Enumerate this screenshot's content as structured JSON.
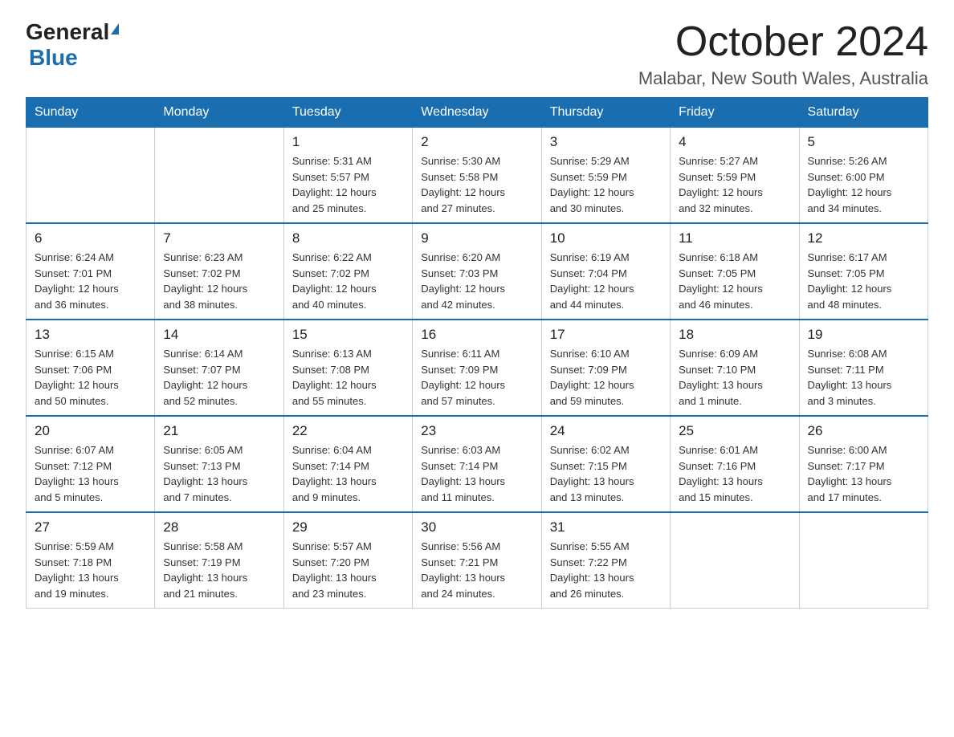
{
  "header": {
    "logo_general": "General",
    "logo_blue": "Blue",
    "title": "October 2024",
    "subtitle": "Malabar, New South Wales, Australia"
  },
  "weekdays": [
    "Sunday",
    "Monday",
    "Tuesday",
    "Wednesday",
    "Thursday",
    "Friday",
    "Saturday"
  ],
  "weeks": [
    [
      {
        "day": "",
        "info": ""
      },
      {
        "day": "",
        "info": ""
      },
      {
        "day": "1",
        "info": "Sunrise: 5:31 AM\nSunset: 5:57 PM\nDaylight: 12 hours\nand 25 minutes."
      },
      {
        "day": "2",
        "info": "Sunrise: 5:30 AM\nSunset: 5:58 PM\nDaylight: 12 hours\nand 27 minutes."
      },
      {
        "day": "3",
        "info": "Sunrise: 5:29 AM\nSunset: 5:59 PM\nDaylight: 12 hours\nand 30 minutes."
      },
      {
        "day": "4",
        "info": "Sunrise: 5:27 AM\nSunset: 5:59 PM\nDaylight: 12 hours\nand 32 minutes."
      },
      {
        "day": "5",
        "info": "Sunrise: 5:26 AM\nSunset: 6:00 PM\nDaylight: 12 hours\nand 34 minutes."
      }
    ],
    [
      {
        "day": "6",
        "info": "Sunrise: 6:24 AM\nSunset: 7:01 PM\nDaylight: 12 hours\nand 36 minutes."
      },
      {
        "day": "7",
        "info": "Sunrise: 6:23 AM\nSunset: 7:02 PM\nDaylight: 12 hours\nand 38 minutes."
      },
      {
        "day": "8",
        "info": "Sunrise: 6:22 AM\nSunset: 7:02 PM\nDaylight: 12 hours\nand 40 minutes."
      },
      {
        "day": "9",
        "info": "Sunrise: 6:20 AM\nSunset: 7:03 PM\nDaylight: 12 hours\nand 42 minutes."
      },
      {
        "day": "10",
        "info": "Sunrise: 6:19 AM\nSunset: 7:04 PM\nDaylight: 12 hours\nand 44 minutes."
      },
      {
        "day": "11",
        "info": "Sunrise: 6:18 AM\nSunset: 7:05 PM\nDaylight: 12 hours\nand 46 minutes."
      },
      {
        "day": "12",
        "info": "Sunrise: 6:17 AM\nSunset: 7:05 PM\nDaylight: 12 hours\nand 48 minutes."
      }
    ],
    [
      {
        "day": "13",
        "info": "Sunrise: 6:15 AM\nSunset: 7:06 PM\nDaylight: 12 hours\nand 50 minutes."
      },
      {
        "day": "14",
        "info": "Sunrise: 6:14 AM\nSunset: 7:07 PM\nDaylight: 12 hours\nand 52 minutes."
      },
      {
        "day": "15",
        "info": "Sunrise: 6:13 AM\nSunset: 7:08 PM\nDaylight: 12 hours\nand 55 minutes."
      },
      {
        "day": "16",
        "info": "Sunrise: 6:11 AM\nSunset: 7:09 PM\nDaylight: 12 hours\nand 57 minutes."
      },
      {
        "day": "17",
        "info": "Sunrise: 6:10 AM\nSunset: 7:09 PM\nDaylight: 12 hours\nand 59 minutes."
      },
      {
        "day": "18",
        "info": "Sunrise: 6:09 AM\nSunset: 7:10 PM\nDaylight: 13 hours\nand 1 minute."
      },
      {
        "day": "19",
        "info": "Sunrise: 6:08 AM\nSunset: 7:11 PM\nDaylight: 13 hours\nand 3 minutes."
      }
    ],
    [
      {
        "day": "20",
        "info": "Sunrise: 6:07 AM\nSunset: 7:12 PM\nDaylight: 13 hours\nand 5 minutes."
      },
      {
        "day": "21",
        "info": "Sunrise: 6:05 AM\nSunset: 7:13 PM\nDaylight: 13 hours\nand 7 minutes."
      },
      {
        "day": "22",
        "info": "Sunrise: 6:04 AM\nSunset: 7:14 PM\nDaylight: 13 hours\nand 9 minutes."
      },
      {
        "day": "23",
        "info": "Sunrise: 6:03 AM\nSunset: 7:14 PM\nDaylight: 13 hours\nand 11 minutes."
      },
      {
        "day": "24",
        "info": "Sunrise: 6:02 AM\nSunset: 7:15 PM\nDaylight: 13 hours\nand 13 minutes."
      },
      {
        "day": "25",
        "info": "Sunrise: 6:01 AM\nSunset: 7:16 PM\nDaylight: 13 hours\nand 15 minutes."
      },
      {
        "day": "26",
        "info": "Sunrise: 6:00 AM\nSunset: 7:17 PM\nDaylight: 13 hours\nand 17 minutes."
      }
    ],
    [
      {
        "day": "27",
        "info": "Sunrise: 5:59 AM\nSunset: 7:18 PM\nDaylight: 13 hours\nand 19 minutes."
      },
      {
        "day": "28",
        "info": "Sunrise: 5:58 AM\nSunset: 7:19 PM\nDaylight: 13 hours\nand 21 minutes."
      },
      {
        "day": "29",
        "info": "Sunrise: 5:57 AM\nSunset: 7:20 PM\nDaylight: 13 hours\nand 23 minutes."
      },
      {
        "day": "30",
        "info": "Sunrise: 5:56 AM\nSunset: 7:21 PM\nDaylight: 13 hours\nand 24 minutes."
      },
      {
        "day": "31",
        "info": "Sunrise: 5:55 AM\nSunset: 7:22 PM\nDaylight: 13 hours\nand 26 minutes."
      },
      {
        "day": "",
        "info": ""
      },
      {
        "day": "",
        "info": ""
      }
    ]
  ]
}
